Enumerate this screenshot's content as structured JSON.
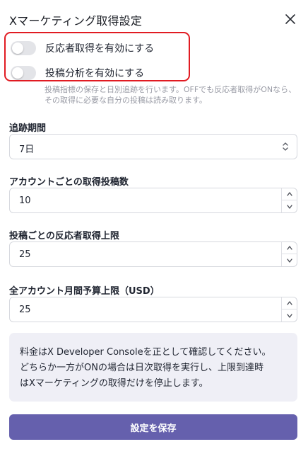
{
  "dialog": {
    "title": "Xマーケティング取得設定"
  },
  "toggles": [
    {
      "label": "反応者取得を有効にする",
      "on": false
    },
    {
      "label": "投稿分析を有効にする",
      "on": false
    }
  ],
  "help_text": "投稿指標の保存と日別追跡を行います。OFFでも反応者取得がONなら、その取得に必要な自分の投稿は読み取ります。",
  "fields": {
    "tracking_period": {
      "label": "追跡期間",
      "value": "7日"
    },
    "posts_per_account": {
      "label": "アカウントごとの取得投稿数",
      "value": "10"
    },
    "responders_per_post": {
      "label": "投稿ごとの反応者取得上限",
      "value": "25"
    },
    "monthly_budget": {
      "label": "全アカウント月間予算上限（USD）",
      "value": "25"
    }
  },
  "note": {
    "lines": [
      "料金はX Developer Consoleを正として確認してください。",
      "どちらか一方がONの場合は日次取得を実行し、上限到達時",
      "はXマーケティングの取得だけを停止します。"
    ]
  },
  "save_button": {
    "label": "設定を保存"
  },
  "colors": {
    "accent": "#6560ad",
    "highlight": "#e11b22",
    "note_bg": "#efeff6"
  }
}
